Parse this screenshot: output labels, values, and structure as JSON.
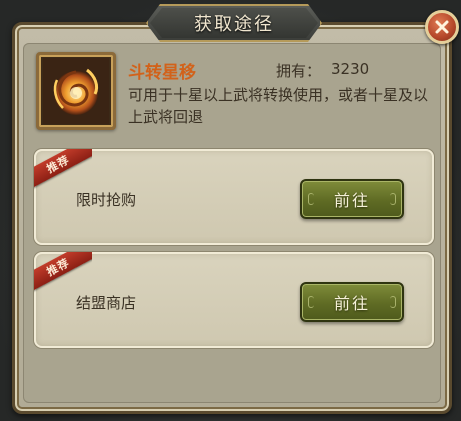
{
  "dialog": {
    "title": "获取途径"
  },
  "item": {
    "name": "斗转星移",
    "owned_label": "拥有：",
    "owned_value": "3230",
    "description": "可用于十星以上武将转换使用，或者十星及以上武将回退",
    "icon": "swirl-emblem-icon"
  },
  "sources": [
    {
      "badge": "推荐",
      "label": "限时抢购",
      "button": "前往"
    },
    {
      "badge": "推荐",
      "label": "结盟商店",
      "button": "前往"
    }
  ],
  "colors": {
    "item_name": "#d2621a",
    "go_button": "#5f6b24",
    "ribbon": "#c23c2a",
    "close_button": "#b4472a"
  }
}
